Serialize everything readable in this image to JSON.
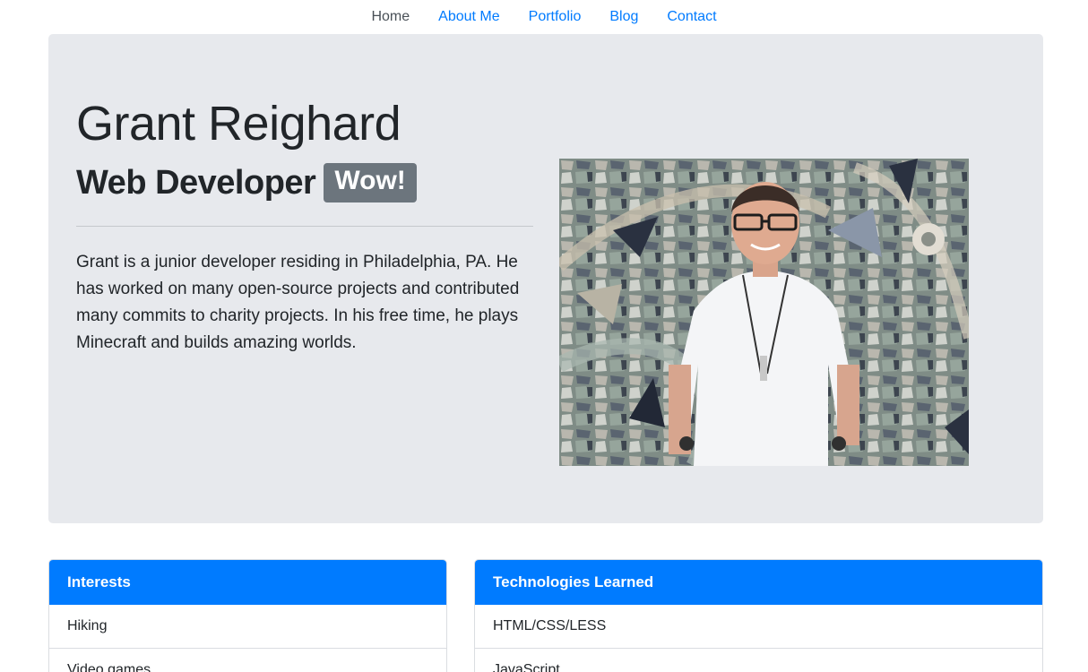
{
  "nav": {
    "items": [
      {
        "label": "Home",
        "active": true
      },
      {
        "label": "About Me",
        "active": false
      },
      {
        "label": "Portfolio",
        "active": false
      },
      {
        "label": "Blog",
        "active": false
      },
      {
        "label": "Contact",
        "active": false
      }
    ]
  },
  "hero": {
    "name": "Grant Reighard",
    "role": "Web Developer",
    "badge": "Wow!",
    "bio": "Grant is a junior developer residing in Philadelphia, PA. He has worked on many open-source projects and contributed many commits to charity projects. In his free time, he plays Minecraft and builds amazing worlds."
  },
  "cards": {
    "interests": {
      "header": "Interests",
      "items": [
        "Hiking",
        "Video games"
      ]
    },
    "technologies": {
      "header": "Technologies Learned",
      "items": [
        "HTML/CSS/LESS",
        "JavaScript"
      ]
    }
  },
  "colors": {
    "primary": "#007bff",
    "jumbotron_bg": "#e7e9ed",
    "badge_bg": "#6c757d",
    "nav_active": "#495057"
  }
}
